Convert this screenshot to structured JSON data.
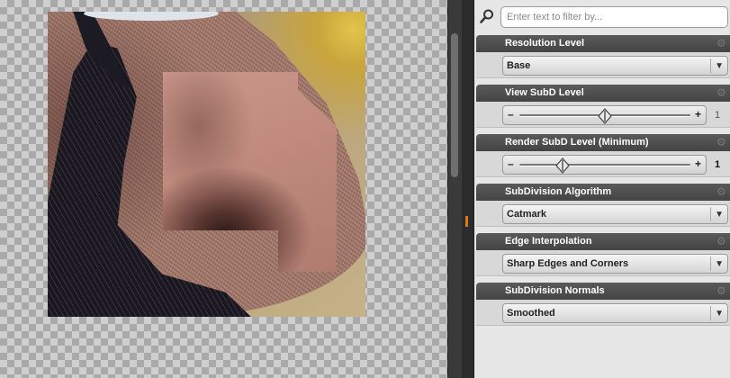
{
  "filter": {
    "placeholder": "Enter text to filter by...",
    "icon": "search-icon"
  },
  "sections": [
    {
      "title": "Resolution Level",
      "type": "dropdown",
      "value": "Base"
    },
    {
      "title": "View SubD Level",
      "type": "slider",
      "value": "1",
      "level": 0.5
    },
    {
      "title": "Render SubD Level (Minimum)",
      "type": "slider",
      "value": "1",
      "level": 0.25
    },
    {
      "title": "SubDivision Algorithm",
      "type": "dropdown",
      "value": "Catmark"
    },
    {
      "title": "Edge Interpolation",
      "type": "dropdown",
      "value": "Sharp Edges and Corners"
    },
    {
      "title": "SubDivision Normals",
      "type": "dropdown",
      "value": "Smoothed"
    }
  ],
  "colors": {
    "header": "#4a4a4a",
    "panel": "#e6e6e6",
    "accent": "#d57a1e"
  }
}
